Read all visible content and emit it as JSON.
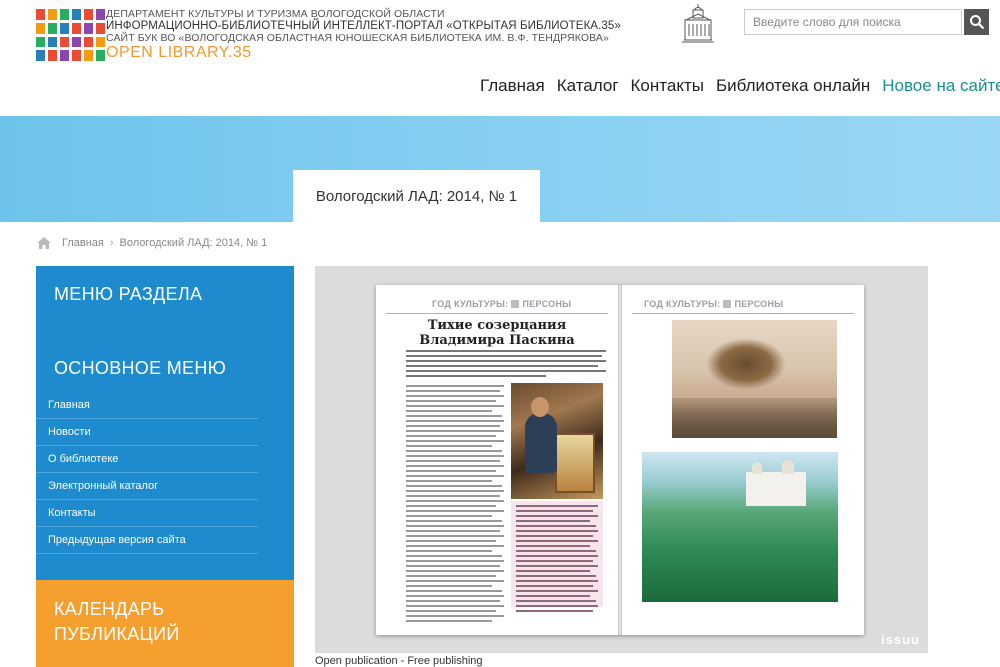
{
  "header": {
    "org_line1": "ДЕПАРТАМЕНТ КУЛЬТУРЫ И ТУРИЗМА ВОЛОГОДСКОЙ ОБЛАСТИ",
    "org_line2": "ИНФОРМАЦИОННО-БИБЛИОТЕЧНЫЙ ИНТЕЛЛЕКТ-ПОРТАЛ «ОТКРЫТАЯ БИБЛИОТЕКА.35»",
    "org_line3": "САЙТ БУК ВО «ВОЛОГОДСКАЯ ОБЛАСТНАЯ ЮНОШЕСКАЯ БИБЛИОТЕКА ИМ. В.Ф. ТЕНДРЯКОВА»",
    "brand": "OPEN LIBRARY.35",
    "logo_colors": [
      "#e94b35",
      "#f39c12",
      "#27ae60",
      "#2980b9",
      "#e94b35",
      "#8e44ad"
    ],
    "building_icon": "library-building-icon"
  },
  "search": {
    "placeholder": "Введите слово для поиска",
    "icon": "search-icon"
  },
  "nav": {
    "items": [
      "Главная",
      "Каталог",
      "Контакты",
      "Библиотека онлайн",
      "Новое на сайте"
    ]
  },
  "page": {
    "title": "Вологодский ЛАД: 2014, № 1"
  },
  "breadcrumb": {
    "home": "Главная",
    "current": "Вологодский ЛАД: 2014, № 1"
  },
  "sidebar": {
    "section_menu_heading": "МЕНЮ РАЗДЕЛА",
    "main_menu_heading": "ОСНОВНОЕ МЕНЮ",
    "items": [
      "Главная",
      "Новости",
      "О библиотеке",
      "Электронный каталог",
      "Контакты",
      "Предыдущая версия сайта"
    ],
    "accent_color": "#1e8bcf"
  },
  "calendar": {
    "title": "КАЛЕНДАРЬ ПУБЛИКАЦИЙ",
    "accent_color": "#f5a02e"
  },
  "viewer": {
    "section_label_left": "ГОД КУЛЬТУРЫ:",
    "section_label_right": "ПЕРСОНЫ",
    "article_title_line1": "Тихие созерцания",
    "article_title_line2": "Владимира Паскина",
    "watermark": "issuu",
    "caption": "Open publication - Free publishing"
  }
}
